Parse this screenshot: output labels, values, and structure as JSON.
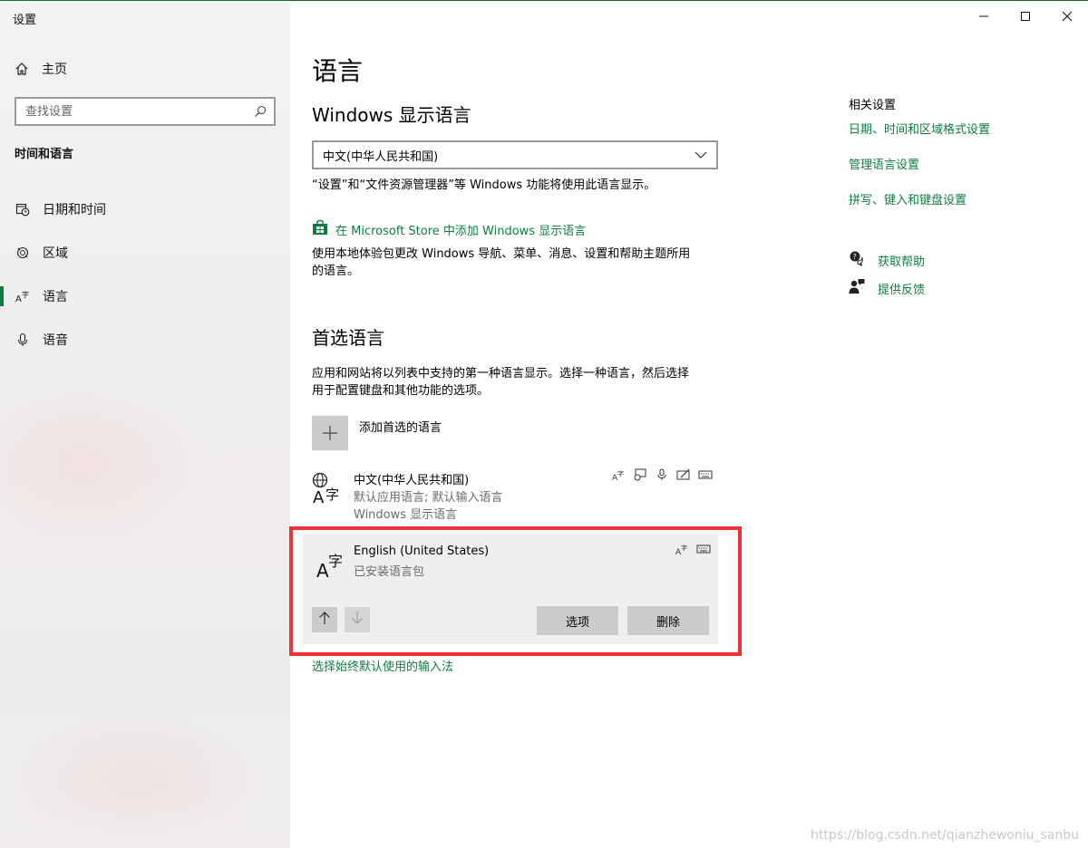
{
  "window": {
    "title": "设置"
  },
  "sidebar": {
    "home_label": "主页",
    "search_placeholder": "查找设置",
    "section_title": "时间和语言",
    "items": [
      {
        "label": "日期和时间",
        "icon": "calendar-clock-icon"
      },
      {
        "label": "区域",
        "icon": "globe-region-icon"
      },
      {
        "label": "语言",
        "icon": "language-icon",
        "active": true
      },
      {
        "label": "语音",
        "icon": "microphone-icon"
      }
    ]
  },
  "main": {
    "page_title": "语言",
    "display_language": {
      "heading": "Windows 显示语言",
      "selected": "中文(中华人民共和国)",
      "description": "“设置”和“文件资源管理器”等 Windows 功能将使用此语言显示。",
      "store_link": "在 Microsoft Store 中添加 Windows 显示语言",
      "store_desc_line1": "使用本地体验包更改 Windows 导航、菜单、消息、设置和帮助主题所用",
      "store_desc_line2": "的语言。"
    },
    "preferred": {
      "heading": "首选语言",
      "desc_line1": "应用和网站将以列表中支持的第一种语言显示。选择一种语言，然后选择",
      "desc_line2": "用于配置键盘和其他功能的选项。",
      "add_label": "添加首选的语言",
      "languages": [
        {
          "name": "中文(中华人民共和国)",
          "sub1": "默认应用语言; 默认输入语言",
          "sub2": "Windows 显示语言"
        },
        {
          "name": "English (United States)",
          "sub1": "已安装语言包",
          "options_label": "选项",
          "remove_label": "删除"
        }
      ],
      "ime_link": "选择始终默认使用的输入法"
    }
  },
  "related": {
    "heading": "相关设置",
    "links": [
      "日期、时间和区域格式设置",
      "管理语言设置",
      "拼写、键入和键盘设置"
    ],
    "help": "获取帮助",
    "feedback": "提供反馈"
  },
  "colors": {
    "accent": "#107c41",
    "highlight_border": "#ee3338"
  },
  "watermark": "https://blog.csdn.net/qianzhewoniu_sanbu"
}
